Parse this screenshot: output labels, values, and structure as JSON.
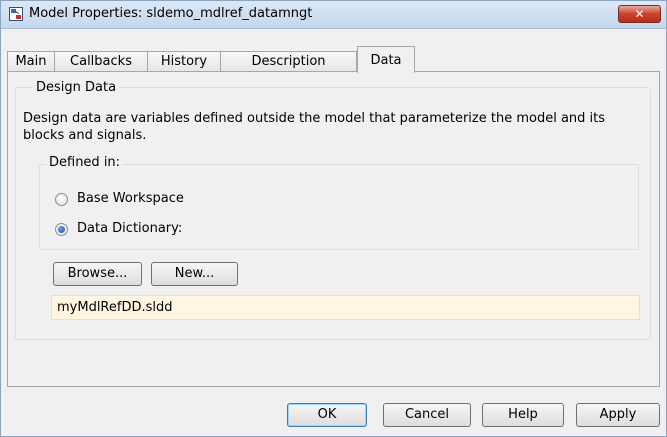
{
  "window": {
    "title": "Model Properties: sldemo_mdlref_datamngt",
    "close_label": "✕"
  },
  "tabs": [
    {
      "label": "Main"
    },
    {
      "label": "Callbacks"
    },
    {
      "label": "History"
    },
    {
      "label": "Description"
    },
    {
      "label": "Data",
      "active": true
    }
  ],
  "design_data": {
    "legend": "Design Data",
    "description": "Design data are variables defined outside the model that parameterize the model and its blocks and signals.",
    "defined_in": {
      "legend": "Defined in:",
      "options": [
        {
          "label": "Base Workspace",
          "selected": false
        },
        {
          "label": "Data Dictionary:",
          "selected": true
        }
      ]
    },
    "browse_label": "Browse...",
    "new_label": "New...",
    "dictionary_value": "myMdlRefDD.sldd"
  },
  "footer": {
    "ok_label": "OK",
    "cancel_label": "Cancel",
    "help_label": "Help",
    "apply_label": "Apply"
  }
}
